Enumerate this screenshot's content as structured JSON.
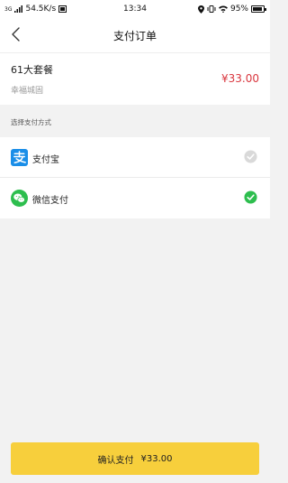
{
  "status_bar": {
    "network": "3G",
    "speed": "54.5K/s",
    "time": "13:34",
    "battery": "95%",
    "battery_level": 0.95
  },
  "nav": {
    "title": "支付订单",
    "back_icon": "chevron-left-icon"
  },
  "order": {
    "name": "61大套餐",
    "shop": "幸福城固",
    "price": "¥33.00"
  },
  "payment": {
    "section_label": "选择支付方式",
    "methods": [
      {
        "label": "支付宝",
        "icon": "alipay-icon",
        "selected": false
      },
      {
        "label": "微信支付",
        "icon": "wechat-icon",
        "selected": true
      }
    ]
  },
  "confirm": {
    "label": "确认支付",
    "amount": "¥33.00"
  },
  "colors": {
    "accent": "#f7cf3c",
    "price_red": "#d9363e",
    "check_green": "#2dbe4e",
    "alipay_blue": "#1a8ee8",
    "wechat_green": "#2dbe4e"
  }
}
